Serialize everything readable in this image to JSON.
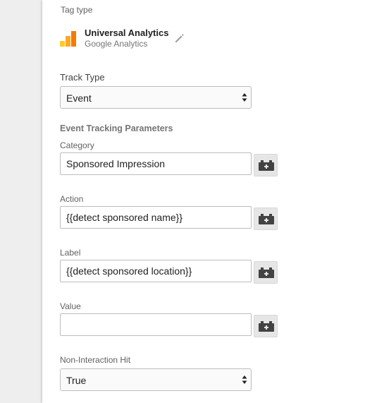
{
  "tag_type": {
    "label": "Tag type",
    "name": "Universal Analytics",
    "provider": "Google Analytics",
    "logo_icon": "google-analytics-logo-icon",
    "edit_icon": "pencil-icon"
  },
  "track_type": {
    "label": "Track Type",
    "selected": "Event"
  },
  "event_params": {
    "heading": "Event Tracking Parameters",
    "category": {
      "label": "Category",
      "value": "Sponsored Impression"
    },
    "action": {
      "label": "Action",
      "value": "{{detect sponsored name}}"
    },
    "label_field": {
      "label": "Label",
      "value": "{{detect sponsored location}}"
    },
    "value_field": {
      "label": "Value",
      "value": ""
    },
    "variable_button_icon": "add-variable-brick-icon"
  },
  "non_interaction": {
    "label": "Non-Interaction Hit",
    "selected": "True"
  },
  "colors": {
    "logo_orange": "#f57c00",
    "logo_yellow": "#ffca28",
    "border": "#bdbdbd",
    "gutter": "#eeeeee"
  }
}
